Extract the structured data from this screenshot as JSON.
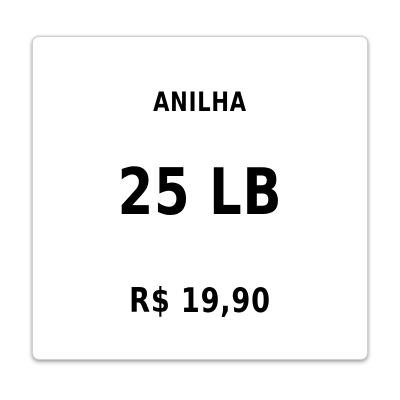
{
  "card": {
    "product_name": "ANILHA",
    "size_label": "25 LB",
    "price": "R$ 19,90"
  },
  "colors": {
    "background": "#ffffff",
    "text": "#000000",
    "card_border": "#cfcfcf"
  }
}
